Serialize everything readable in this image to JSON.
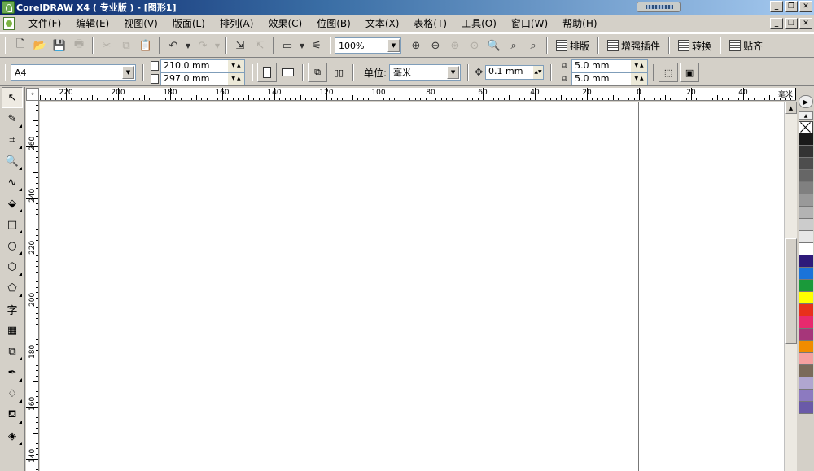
{
  "window": {
    "title": "CorelDRAW X4 ( 专业版 ) - [图形1]",
    "buttons": [
      "_",
      "❐",
      "✕"
    ]
  },
  "menu": [
    {
      "label": "文件(F)",
      "name": "menu-file"
    },
    {
      "label": "编辑(E)",
      "name": "menu-edit"
    },
    {
      "label": "视图(V)",
      "name": "menu-view"
    },
    {
      "label": "版面(L)",
      "name": "menu-layout"
    },
    {
      "label": "排列(A)",
      "name": "menu-arrange"
    },
    {
      "label": "效果(C)",
      "name": "menu-effects"
    },
    {
      "label": "位图(B)",
      "name": "menu-bitmaps"
    },
    {
      "label": "文本(X)",
      "name": "menu-text"
    },
    {
      "label": "表格(T)",
      "name": "menu-table"
    },
    {
      "label": "工具(O)",
      "name": "menu-tools"
    },
    {
      "label": "窗口(W)",
      "name": "menu-window"
    },
    {
      "label": "帮助(H)",
      "name": "menu-help"
    }
  ],
  "std_toolbar": {
    "zoom_value": "100%",
    "plugins": [
      {
        "label": "排版",
        "name": "typeset-button"
      },
      {
        "label": "增强插件",
        "name": "enhance-plugin-button"
      },
      {
        "label": "转换",
        "name": "convert-button"
      },
      {
        "label": "贴齐",
        "name": "snap-button"
      }
    ]
  },
  "prop_toolbar": {
    "paper_size": "A4",
    "width": "210.0 mm",
    "height": "297.0 mm",
    "unit_label": "单位:",
    "unit_value": "毫米",
    "nudge": "0.1 mm",
    "dup_x": "5.0 mm",
    "dup_y": "5.0 mm"
  },
  "rulers": {
    "unit": "毫米",
    "h_labels": [
      "220",
      "200",
      "180",
      "160",
      "140",
      "120",
      "100",
      "80",
      "60",
      "40",
      "20",
      "0",
      "20",
      "40"
    ],
    "v_labels": [
      "260",
      "240",
      "220",
      "200",
      "180",
      "160",
      "140"
    ]
  },
  "palette": {
    "colors": [
      "#1a1a1a",
      "#333333",
      "#4d4d4d",
      "#666666",
      "#808080",
      "#999999",
      "#b3b3b3",
      "#cccccc",
      "#e6e6e6",
      "#ffffff",
      "#2e1a7a",
      "#1a73d9",
      "#1a9a3a",
      "#ffff00",
      "#e8301c",
      "#e82a6e",
      "#a6367a",
      "#f08c00",
      "#f5a0a0",
      "#7a6a5a",
      "#b0a6d0",
      "#8c7ac0",
      "#6a5aa8"
    ]
  }
}
